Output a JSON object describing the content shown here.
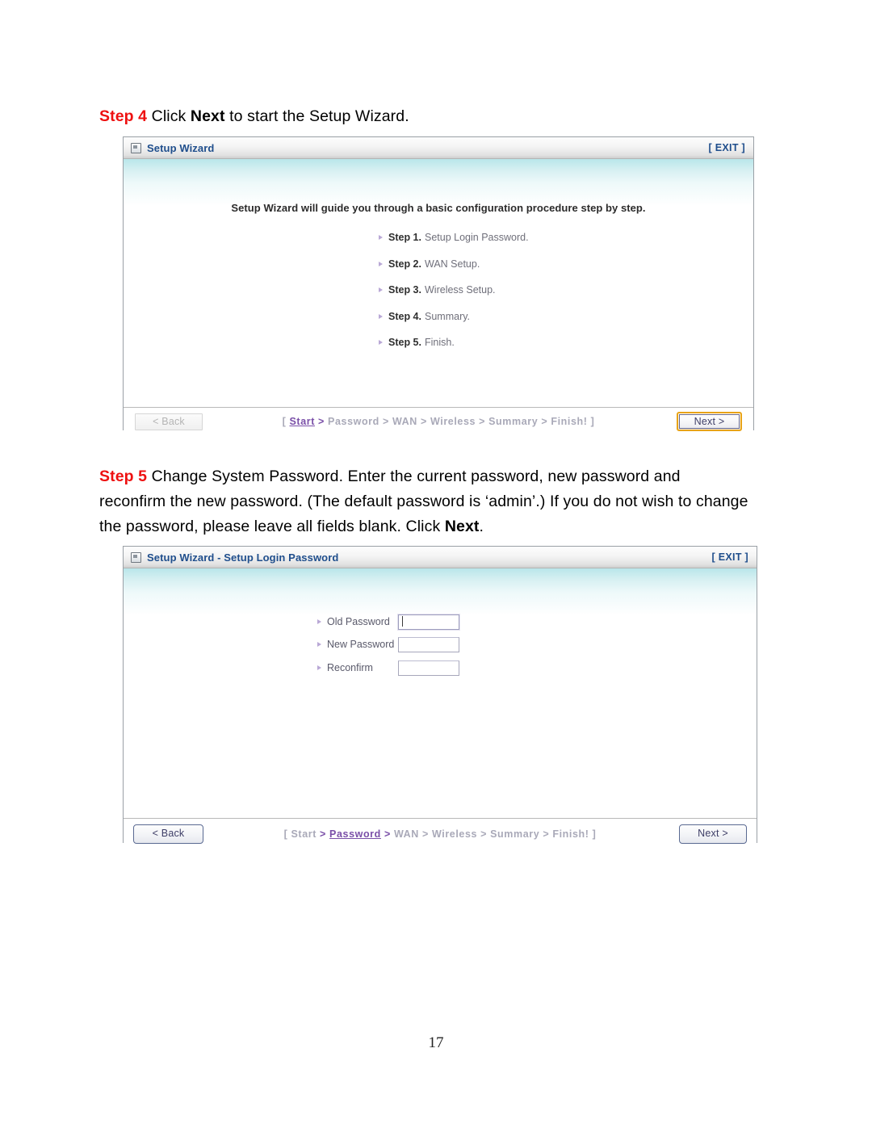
{
  "document": {
    "page_number": "17",
    "step4": {
      "label": "Step 4",
      "text_before": " Click ",
      "bold_word": "Next",
      "text_after": " to start the Setup Wizard."
    },
    "step5": {
      "label": "Step 5",
      "text_part1": " Change System Password. Enter the current password, new password and reconfirm the new password. (The default password is ‘admin’.) If you do not wish to change the password, please leave all fields blank. Click ",
      "bold_word": "Next",
      "text_part2": "."
    }
  },
  "panel_wizard": {
    "title": "Setup Wizard",
    "exit_label": "[ EXIT ]",
    "intro": "Setup Wizard will guide you through a basic configuration procedure step by step.",
    "steps": [
      {
        "num": "Step 1.",
        "text": "Setup Login Password."
      },
      {
        "num": "Step 2.",
        "text": "WAN Setup."
      },
      {
        "num": "Step 3.",
        "text": "Wireless Setup."
      },
      {
        "num": "Step 4.",
        "text": "Summary."
      },
      {
        "num": "Step 5.",
        "text": "Finish."
      }
    ],
    "footer": {
      "back_label": "< Back",
      "next_label": "Next >",
      "breadcrumb": {
        "open": "[ ",
        "close": " ]",
        "items": [
          "Start",
          "Password",
          "WAN",
          "Wireless",
          "Summary",
          "Finish!"
        ],
        "active": "Start",
        "separator": " > "
      }
    }
  },
  "panel_password": {
    "title": "Setup Wizard - Setup Login Password",
    "exit_label": "[ EXIT ]",
    "fields": [
      {
        "label": "Old Password",
        "value": ""
      },
      {
        "label": "New Password",
        "value": ""
      },
      {
        "label": "Reconfirm",
        "value": ""
      }
    ],
    "footer": {
      "back_label": "< Back",
      "next_label": "Next >",
      "breadcrumb": {
        "open": "[ ",
        "close": " ]",
        "items": [
          "Start",
          "Password",
          "WAN",
          "Wireless",
          "Summary",
          "Finish!"
        ],
        "active": "Password",
        "separator": " > "
      }
    }
  },
  "colors": {
    "step_label_red": "#ee1111",
    "panel_title_blue": "#1f4e8c",
    "body_cyan": "#b9e6ea",
    "crumb_active_purple": "#7a4fa8",
    "crumb_inactive_grey": "#a9a9b8",
    "next_focus_orange": "#e8a317"
  }
}
